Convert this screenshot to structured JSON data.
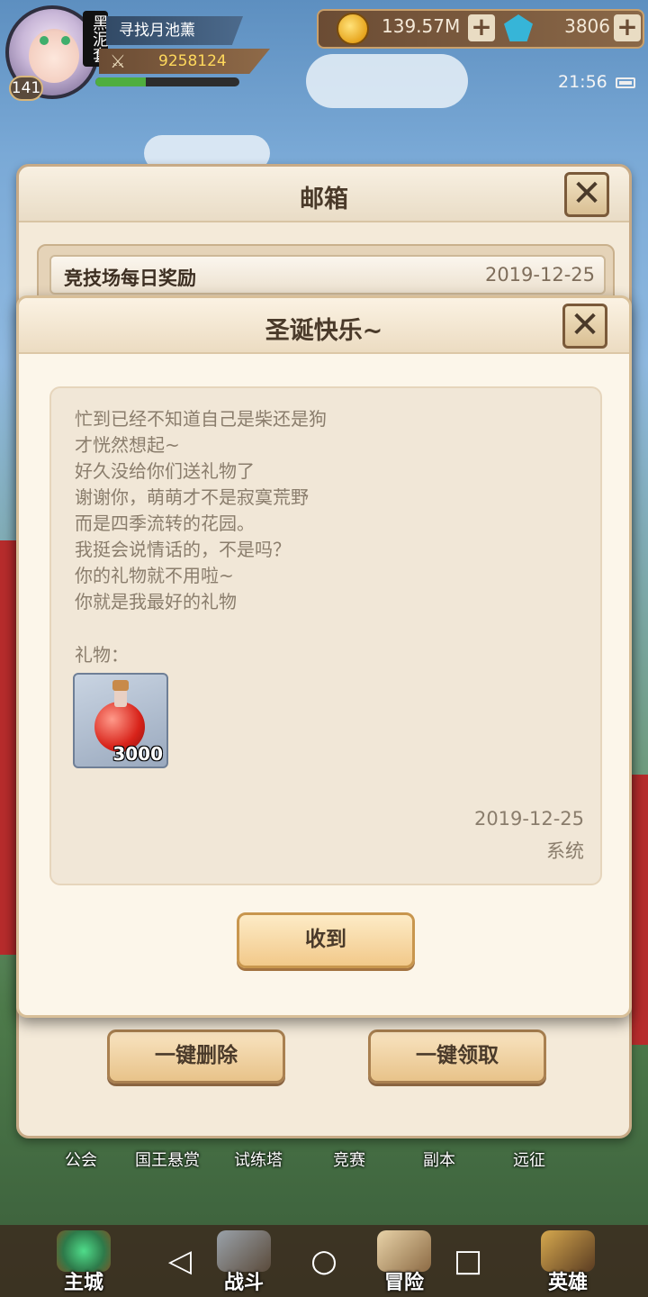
{
  "hud": {
    "level": "141",
    "clan_tag": "黑泥套",
    "player_name": "寻找月池薰",
    "power": "9258124",
    "xp_fraction": 0.35,
    "coins": "139.57M",
    "gems": "3806",
    "time": "21:56"
  },
  "mailbox": {
    "title": "邮箱",
    "items": [
      {
        "title": "竞技场每日奖励",
        "date": "2019-12-25"
      }
    ],
    "delete_all_label": "一键删除",
    "claim_all_label": "一键领取"
  },
  "dialog": {
    "title": "圣诞快乐~",
    "message_lines": [
      "忙到已经不知道自己是柴还是狗",
      "才恍然想起~",
      "好久没给你们送礼物了",
      "谢谢你，萌萌才不是寂寞荒野",
      "而是四季流转的花园。",
      "我挺会说情话的，不是吗？",
      "你的礼物就不用啦~",
      "你就是我最好的礼物"
    ],
    "gift_label": "礼物：",
    "gift": {
      "icon": "red-potion-icon",
      "quantity": "3000"
    },
    "date": "2019-12-25",
    "sender": "系统",
    "receive_label": "收到"
  },
  "menu_strip": [
    "公会",
    "国王悬赏",
    "试练塔",
    "竞赛",
    "副本",
    "远征"
  ],
  "bottom_nav": [
    "主城",
    "战斗",
    "冒险",
    "英雄"
  ],
  "colors": {
    "accent": "#f2c98a",
    "panel": "#fcf6ea",
    "text_dark": "#4a3a2a",
    "text_muted": "#8a7d6c"
  }
}
